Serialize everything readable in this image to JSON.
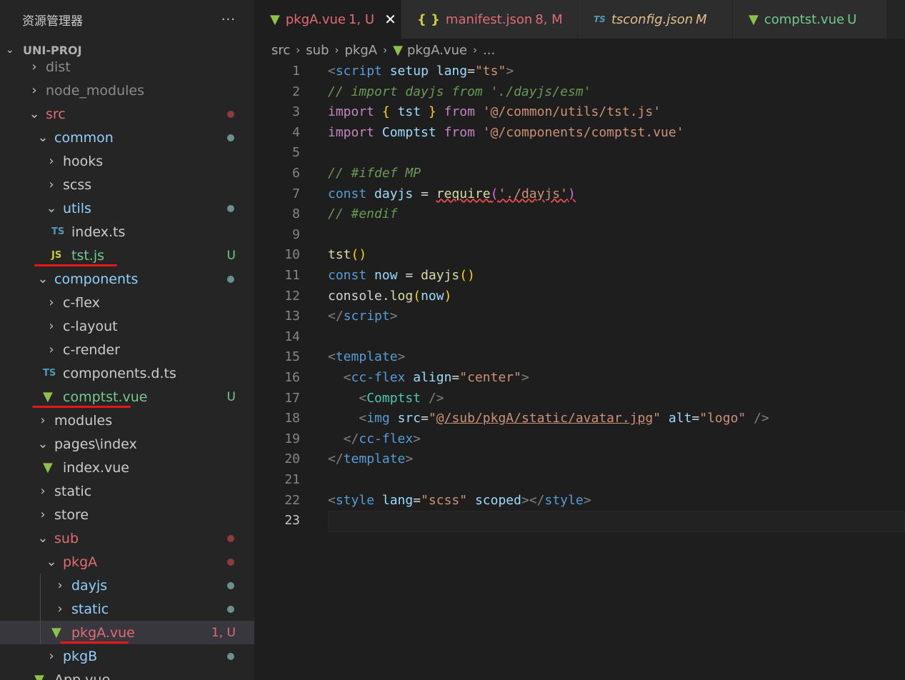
{
  "explorer": {
    "title": "资源管理器",
    "more": "···",
    "project": "UNI-PROJ",
    "rows": [
      {
        "label": "dist",
        "depth": 1,
        "twisty": "›",
        "color": "#8b8b8b"
      },
      {
        "label": "node_modules",
        "depth": 1,
        "twisty": "›",
        "color": "#8b8b8b"
      },
      {
        "label": "src",
        "depth": 1,
        "twisty": "⌄",
        "color": "#e06c75",
        "dot": "#8c3c3c"
      },
      {
        "label": "common",
        "depth": 2,
        "twisty": "⌄",
        "color": "#8fd0ff",
        "dot": "#6c8f8f"
      },
      {
        "label": "hooks",
        "depth": 3,
        "twisty": "›",
        "color": "#cccccc"
      },
      {
        "label": "scss",
        "depth": 3,
        "twisty": "›",
        "color": "#cccccc"
      },
      {
        "label": "utils",
        "depth": 3,
        "twisty": "⌄",
        "color": "#8fd0ff",
        "dot": "#6c8f8f"
      },
      {
        "label": "index.ts",
        "depth": 4,
        "icon": "TS",
        "iconColor": "#519aba",
        "color": "#cccccc"
      },
      {
        "label": "tst.js",
        "depth": 4,
        "icon": "JS",
        "iconColor": "#cbcb41",
        "color": "#73c991",
        "badge": "U",
        "badgeColor": "#73c991"
      },
      {
        "label": "components",
        "depth": 2,
        "twisty": "⌄",
        "color": "#8fd0ff",
        "dot": "#6c8f8f"
      },
      {
        "label": "c-flex",
        "depth": 3,
        "twisty": "›",
        "color": "#cccccc"
      },
      {
        "label": "c-layout",
        "depth": 3,
        "twisty": "›",
        "color": "#cccccc"
      },
      {
        "label": "c-render",
        "depth": 3,
        "twisty": "›",
        "color": "#cccccc"
      },
      {
        "label": "components.d.ts",
        "depth": 3,
        "icon": "TS",
        "iconColor": "#519aba",
        "color": "#cccccc"
      },
      {
        "label": "comptst.vue",
        "depth": 3,
        "icon": "V",
        "iconColor": "#8dc149",
        "color": "#73c991",
        "badge": "U",
        "badgeColor": "#73c991"
      },
      {
        "label": "modules",
        "depth": 2,
        "twisty": "›",
        "color": "#cccccc"
      },
      {
        "label": "pages\\index",
        "depth": 2,
        "twisty": "⌄",
        "color": "#cccccc"
      },
      {
        "label": "index.vue",
        "depth": 3,
        "icon": "V",
        "iconColor": "#8dc149",
        "color": "#cccccc"
      },
      {
        "label": "static",
        "depth": 2,
        "twisty": "›",
        "color": "#cccccc"
      },
      {
        "label": "store",
        "depth": 2,
        "twisty": "›",
        "color": "#cccccc"
      },
      {
        "label": "sub",
        "depth": 2,
        "twisty": "⌄",
        "color": "#e06c75",
        "dot": "#8c3c3c"
      },
      {
        "label": "pkgA",
        "depth": 3,
        "twisty": "⌄",
        "color": "#e06c75",
        "dot": "#8c3c3c"
      },
      {
        "label": "dayjs",
        "depth": 4,
        "twisty": "›",
        "color": "#8fd0ff",
        "dot": "#6c8f8f"
      },
      {
        "label": "static",
        "depth": 4,
        "twisty": "›",
        "color": "#8fd0ff",
        "dot": "#6c8f8f"
      },
      {
        "label": "pkgA.vue",
        "depth": 4,
        "icon": "V",
        "iconColor": "#8dc149",
        "color": "#e06c75",
        "badge": "1, U",
        "badgeColor": "#e06c75",
        "selected": true
      },
      {
        "label": "pkgB",
        "depth": 3,
        "twisty": "›",
        "color": "#8fd0ff",
        "dot": "#6c8f8f"
      },
      {
        "label": "App.vue",
        "depth": 2,
        "icon": "V",
        "iconColor": "#8dc149",
        "color": "#cccccc"
      }
    ]
  },
  "tabs": [
    {
      "label": "pkgA.vue",
      "meta": "1, U",
      "icon": "V",
      "iconColor": "#8dc149",
      "color": "#e06c75",
      "active": true,
      "close": "✕"
    },
    {
      "label": "manifest.json",
      "meta": "8, M",
      "icon": "{ }",
      "iconColor": "#cbcb41",
      "color": "#e06c75"
    },
    {
      "label": "tsconfig.json",
      "meta": "M",
      "icon": "TS",
      "iconColor": "#519aba",
      "color": "#e2c08d",
      "italic": true
    },
    {
      "label": "comptst.vue",
      "meta": "U",
      "icon": "V",
      "iconColor": "#8dc149",
      "color": "#73c991"
    }
  ],
  "breadcrumb": {
    "items": [
      "src",
      "sub",
      "pkgA",
      "pkgA.vue",
      "..."
    ],
    "sep": "›"
  },
  "code": {
    "current_line": 23,
    "lines": [
      {
        "n": "1",
        "html": "<span class='p'>&lt;</span><span class='k'>script</span> <span class='a'>setup</span> <span class='a'>lang</span><span class='w'>=</span><span class='s'>\"ts\"</span><span class='p'>&gt;</span>"
      },
      {
        "n": "2",
        "html": "<span class='c'>// import dayjs from './dayjs/esm'</span>"
      },
      {
        "n": "3",
        "html": "<span class='kc'>import</span> <span class='y'>{</span> <span class='v'>tst</span> <span class='y'>}</span> <span class='kc'>from</span> <span class='s'>'@/common/utils/tst.js'</span>"
      },
      {
        "n": "4",
        "html": "<span class='kc'>import</span> <span class='v'>Comptst</span> <span class='kc'>from</span> <span class='s'>'@/components/comptst.vue'</span>"
      },
      {
        "n": "5",
        "html": ""
      },
      {
        "n": "6",
        "html": "<span class='c'>// #ifdef MP</span>"
      },
      {
        "n": "7",
        "html": "<span class='k'>const</span> <span class='v'>dayjs</span> <span class='w'>=</span> <span class='f sq'>require</span><span class='sq'><span class='m'>(</span><span class='s'>'./dayjs'</span><span class='m'>)</span></span>"
      },
      {
        "n": "8",
        "html": "<span class='c'>// #endif</span>"
      },
      {
        "n": "9",
        "html": ""
      },
      {
        "n": "10",
        "html": "<span class='f'>tst</span><span class='y'>()</span>"
      },
      {
        "n": "11",
        "html": "<span class='k'>const</span> <span class='v'>now</span> <span class='w'>=</span> <span class='f'>dayjs</span><span class='y'>()</span>"
      },
      {
        "n": "12",
        "html": "<span class='w'>console</span><span class='w'>.</span><span class='f'>log</span><span class='y'>(</span><span class='v'>now</span><span class='y'>)</span>"
      },
      {
        "n": "13",
        "html": "<span class='p'>&lt;/</span><span class='k'>script</span><span class='p'>&gt;</span>"
      },
      {
        "n": "14",
        "html": ""
      },
      {
        "n": "15",
        "html": "<span class='p'>&lt;</span><span class='k'>template</span><span class='p'>&gt;</span>"
      },
      {
        "n": "16",
        "html": "  <span class='p'>&lt;</span><span class='k'>cc-flex</span> <span class='a'>align</span><span class='w'>=</span><span class='s'>\"center\"</span><span class='p'>&gt;</span>"
      },
      {
        "n": "17",
        "html": "    <span class='p'>&lt;</span><span class='t'>Comptst</span> <span class='p'>/&gt;</span>"
      },
      {
        "n": "18",
        "html": "    <span class='p'>&lt;</span><span class='k'>img</span> <span class='a'>src</span><span class='w'>=</span><span class='s'>\"<span class='ul'>@/sub/pkgA/static/avatar.jpg</span>\"</span> <span class='a'>alt</span><span class='w'>=</span><span class='s'>\"logo\"</span> <span class='p'>/&gt;</span>"
      },
      {
        "n": "19",
        "html": "  <span class='p'>&lt;/</span><span class='k'>cc-flex</span><span class='p'>&gt;</span>"
      },
      {
        "n": "20",
        "html": "<span class='p'>&lt;/</span><span class='k'>template</span><span class='p'>&gt;</span>"
      },
      {
        "n": "21",
        "html": ""
      },
      {
        "n": "22",
        "html": "<span class='p'>&lt;</span><span class='k'>style</span> <span class='a'>lang</span><span class='w'>=</span><span class='s'>\"scss\"</span> <span class='a'>scoped</span><span class='p'>&gt;&lt;/</span><span class='k'>style</span><span class='p'>&gt;</span>"
      },
      {
        "n": "23",
        "html": ""
      }
    ]
  }
}
